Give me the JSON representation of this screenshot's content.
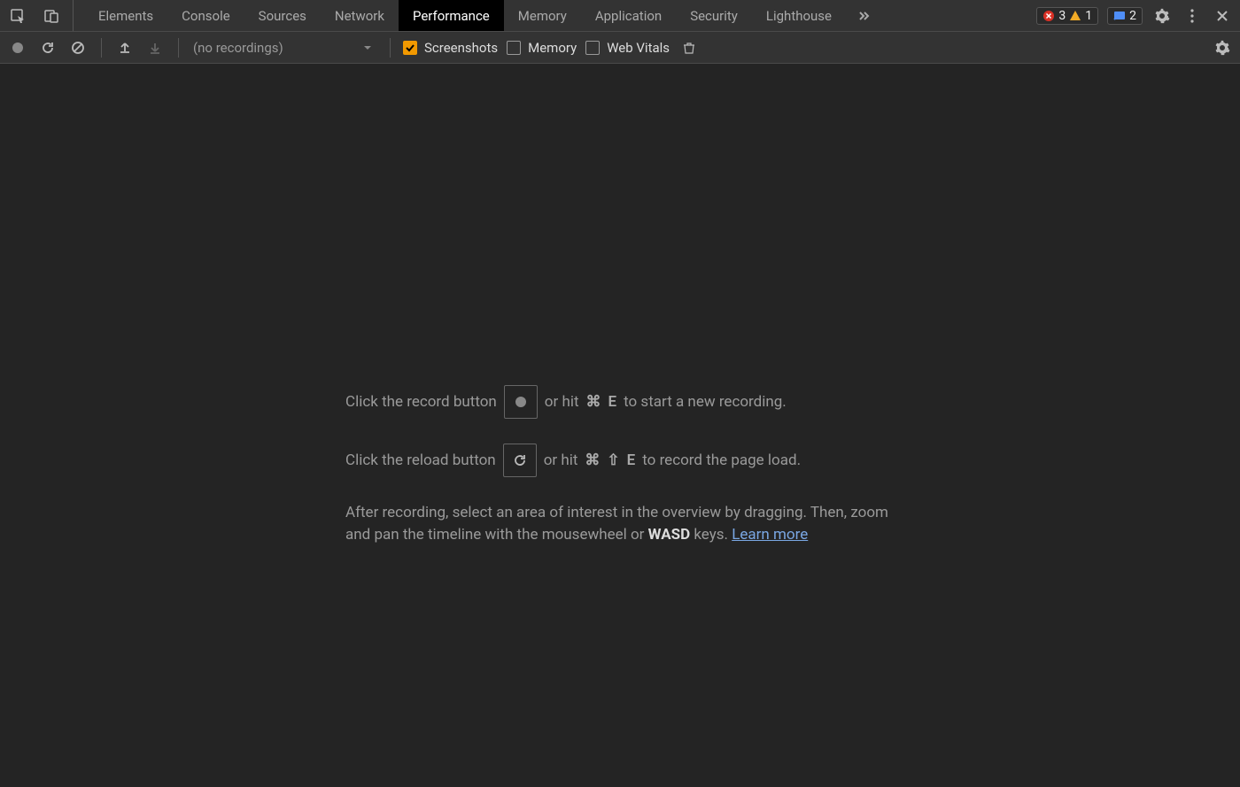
{
  "topbar": {
    "tabs": [
      "Elements",
      "Console",
      "Sources",
      "Network",
      "Performance",
      "Memory",
      "Application",
      "Security",
      "Lighthouse"
    ],
    "activeTab": "Performance",
    "error_count": "3",
    "warn_count": "1",
    "issue_count": "2"
  },
  "toolbar": {
    "recordings_placeholder": "(no recordings)",
    "checkboxes": {
      "screenshots": "Screenshots",
      "memory": "Memory",
      "webvitals": "Web Vitals"
    }
  },
  "content": {
    "line1_a": "Click the record button",
    "line1_b": "or hit",
    "line1_kbd1": "⌘",
    "line1_kbd2": "E",
    "line1_c": "to start a new recording.",
    "line2_a": "Click the reload button",
    "line2_b": "or hit",
    "line2_kbd1": "⌘",
    "line2_kbd2": "⇧",
    "line2_kbd3": "E",
    "line2_c": "to record the page load.",
    "para_a": "After recording, select an area of interest in the overview by dragging. Then, zoom and pan the timeline with the mousewheel or ",
    "para_strong": "WASD",
    "para_b": " keys. ",
    "learn_more": "Learn more"
  }
}
